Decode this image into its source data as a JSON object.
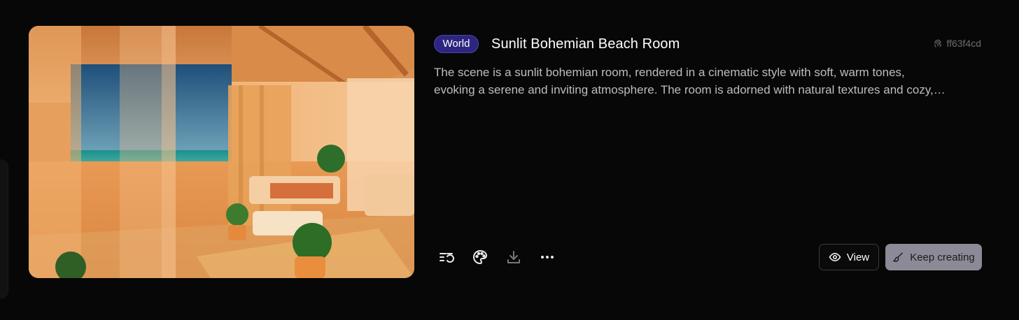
{
  "card": {
    "badge": "World",
    "title": "Sunlit Bohemian Beach Room",
    "id": "ff63f4cd",
    "id_icon": "fingerprint-icon",
    "description_line1": "The scene is a sunlit bohemian room, rendered in a cinematic style with soft, warm tones,",
    "description_line2": "evoking a serene and inviting atmosphere. The room is adorned with natural textures and cozy,…"
  },
  "toolbar": {
    "icons": [
      "list-history-icon",
      "palette-icon",
      "download-icon",
      "more-icon"
    ]
  },
  "actions": {
    "view_label": "View",
    "view_icon": "eye-icon",
    "keep_creating_label": "Keep creating",
    "keep_creating_icon": "brush-icon"
  },
  "colors": {
    "background": "#070707",
    "badge": "#2c2680",
    "keep_creating_bg": "#8b8a96"
  }
}
